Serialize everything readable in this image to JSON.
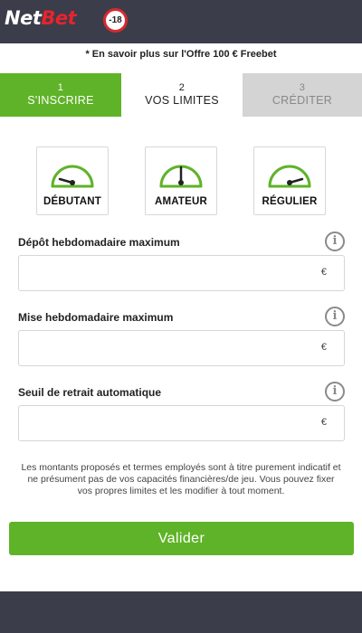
{
  "header": {
    "logo_part1": "Net",
    "logo_part2": "Bet",
    "age_badge": "-18",
    "colors": {
      "background": "#3b3d4b",
      "logo_red": "#e8232d"
    }
  },
  "offer_link": "* En savoir plus sur l'Offre 100 € Freebet",
  "steps": [
    {
      "number": "1",
      "label": "S'INSCRIRE",
      "state": "done"
    },
    {
      "number": "2",
      "label": "VOS LIMITES",
      "state": "active"
    },
    {
      "number": "3",
      "label": "CRÉDITER",
      "state": "pending"
    }
  ],
  "levels": [
    {
      "label": "DÉBUTANT",
      "icon": "gauge-low-icon"
    },
    {
      "label": "AMATEUR",
      "icon": "gauge-mid-icon"
    },
    {
      "label": "RÉGULIER",
      "icon": "gauge-high-icon"
    }
  ],
  "fields": [
    {
      "label": "Dépôt hebdomadaire maximum",
      "value": "",
      "currency": "€"
    },
    {
      "label": "Mise hebdomadaire maximum",
      "value": "",
      "currency": "€"
    },
    {
      "label": "Seuil de retrait automatique",
      "value": "",
      "currency": "€"
    }
  ],
  "info_icon_glyph": "i",
  "disclaimer": "Les montants proposés et termes employés sont à titre purement indicatif et ne présument pas de vos capacités financières/de jeu. Vous pouvez fixer vos propres limites et les modifier à tout moment.",
  "submit_label": "Valider",
  "colors": {
    "accent_green": "#5fb328",
    "inactive_step": "#d4d4d4"
  }
}
